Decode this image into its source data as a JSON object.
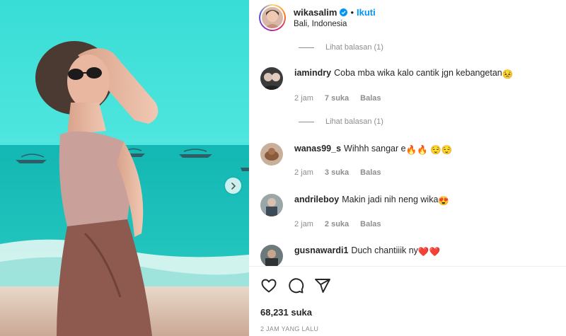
{
  "post": {
    "username": "wikasalim",
    "follow_label": "Ikuti",
    "separator": "•",
    "location": "Bali, Indonesia"
  },
  "icons": {
    "verified": "verified-badge-icon",
    "next": "chevron-right-icon",
    "like": "heart-outline-icon",
    "comment": "speech-bubble-icon",
    "share": "paper-plane-icon"
  },
  "comments": {
    "replies_top": "Lihat balasan (1)",
    "items": [
      {
        "user": "iamindry",
        "text": "Coba mba wika kalo cantik jgn kebangetan",
        "emoji": "😣",
        "time": "2 jam",
        "likes": "7 suka",
        "reply": "Balas",
        "replies": "Lihat balasan (1)"
      },
      {
        "user": "wanas99_s",
        "text": "Wihhh sangar e",
        "emoji": "🔥🔥 😌😌",
        "time": "2 jam",
        "likes": "3 suka",
        "reply": "Balas"
      },
      {
        "user": "andrileboy",
        "text": "Makin jadi nih neng wika",
        "emoji": "😍",
        "time": "2 jam",
        "likes": "2 suka",
        "reply": "Balas"
      },
      {
        "user": "gusnawardi1",
        "text": "Duch chantiiik ny",
        "emoji": "❤️❤️"
      }
    ]
  },
  "footer": {
    "likes": "68,231 suka",
    "time_ago": "2 JAM YANG LALU"
  },
  "colors": {
    "accent": "#0095f6",
    "muted": "#8e8e8e",
    "text": "#262626"
  }
}
